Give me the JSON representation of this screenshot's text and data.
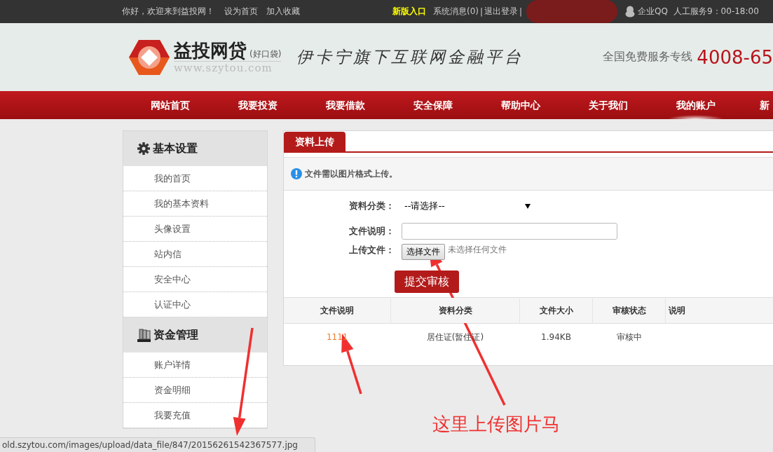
{
  "top_bar": {
    "greeting": "你好，欢迎来到益投网！",
    "links": [
      "设为首页",
      "加入收藏"
    ],
    "new_entry": "新版入口",
    "user_links": [
      "系统消息(0)",
      "退出登录"
    ],
    "separator": "|",
    "redacted": true,
    "qq": "企业QQ",
    "service": "人工服务9：00-18:00"
  },
  "header": {
    "brand": "益投网贷",
    "brand_note": "(好口袋)",
    "domain": "www.szytou.com",
    "slogan": "伊卡宁旗下互联网金融平台",
    "hotline_label": "全国免费服务专线",
    "hotline": "4008-65"
  },
  "nav": [
    {
      "label": "网站首页",
      "selected": false
    },
    {
      "label": "我要投资",
      "selected": false
    },
    {
      "label": "我要借款",
      "selected": false
    },
    {
      "label": "安全保障",
      "selected": false
    },
    {
      "label": "帮助中心",
      "selected": false
    },
    {
      "label": "关于我们",
      "selected": false
    },
    {
      "label": "我的账户",
      "selected": true
    },
    {
      "label": "新",
      "selected": false
    }
  ],
  "sidebar": [
    {
      "title": "基本设置",
      "kind": "gear",
      "items": [
        "我的首页",
        "我的基本资料",
        "头像设置",
        "站内信",
        "安全中心",
        "认证中心"
      ]
    },
    {
      "title": "资金管理",
      "kind": "book",
      "items": [
        "账户详情",
        "资金明细",
        "我要充值"
      ]
    }
  ],
  "panel": {
    "tab": "资料上传",
    "notice": "文件需以图片格式上传。",
    "fields": [
      {
        "kind": "select",
        "label": "资料分类：",
        "value": "--请选择--"
      },
      {
        "kind": "text",
        "label": "文件说明："
      },
      {
        "kind": "file",
        "label": "上传文件：",
        "button": "选择文件",
        "status": "未选择任何文件"
      }
    ],
    "submit": "提交审核",
    "table": {
      "columns": [
        "文件说明",
        "资料分类",
        "文件大小",
        "审核状态",
        "说明"
      ],
      "rows": [
        {
          "cells": [
            "1111",
            "居住证(暂住证)",
            "1.94KB",
            "审核中",
            null
          ]
        }
      ]
    }
  },
  "status_bar": "old.szytou.com/images/upload/data_file/847/20156261542367577.jpg",
  "annotation": "这里上传图片马"
}
